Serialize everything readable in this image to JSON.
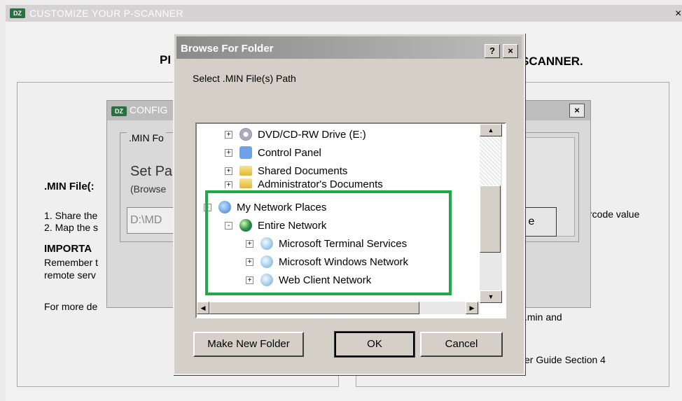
{
  "main_window": {
    "title": "CUSTOMIZE YOUR P-SCANNER",
    "close_glyph": "×",
    "heading_left": "PI",
    "heading_right": "SCANNER.",
    "left_group": {
      "section_heading": ".MIN File(:",
      "step1": "1. Share the",
      "step2": "2. Map the s",
      "important": "IMPORTA",
      "remember": "Remember t",
      "remote": "remote serv",
      "more_details": "For more de"
    },
    "right_group": {
      "barcode_text": "rcode value",
      "min_and": ".min and",
      "guide": "er Guide Section 4"
    }
  },
  "config_dialog": {
    "logo": "DZ",
    "title": "CONFIG",
    "close_glyph": "×",
    "group_label": ".MIN Fo",
    "set_path": "Set Pa",
    "browse_hint": "(Browse",
    "path_value": "D:\\MD",
    "button_fragment": "e"
  },
  "browse_dialog": {
    "title": "Browse For Folder",
    "help_glyph": "?",
    "close_glyph": "×",
    "prompt": "Select .MIN File(s) Path",
    "tree": [
      {
        "label": "DVD/CD-RW Drive (E:)",
        "icon": "cd-drive-icon",
        "expander": "+",
        "level": 1
      },
      {
        "label": "Control Panel",
        "icon": "control-panel-icon",
        "expander": "+",
        "level": 1
      },
      {
        "label": "Shared Documents",
        "icon": "folder-icon",
        "expander": "+",
        "level": 1
      },
      {
        "label": "Administrator's Documents",
        "icon": "folder-icon",
        "expander": "+",
        "level": 1
      },
      {
        "label": "My Network Places",
        "icon": "network-places-icon",
        "expander": "-",
        "level": 0
      },
      {
        "label": "Entire Network",
        "icon": "globe-icon",
        "expander": "-",
        "level": 1
      },
      {
        "label": "Microsoft Terminal Services",
        "icon": "network-icon",
        "expander": "+",
        "level": 2
      },
      {
        "label": "Microsoft Windows Network",
        "icon": "network-icon",
        "expander": "+",
        "level": 2
      },
      {
        "label": "Web Client Network",
        "icon": "network-icon",
        "expander": "+",
        "level": 2
      }
    ],
    "buttons": {
      "make_new_folder": "Make New Folder",
      "ok": "OK",
      "cancel": "Cancel"
    },
    "highlight_color": "#21a847"
  },
  "logo_text": "DZ"
}
